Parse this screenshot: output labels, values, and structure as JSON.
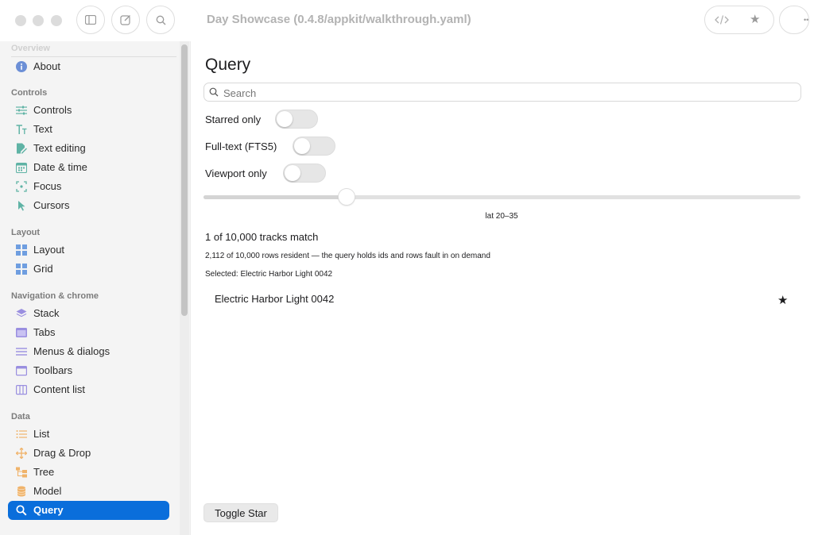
{
  "window": {
    "title": "Day Showcase (0.4.8/appkit/walkthrough.yaml)"
  },
  "toolbar": {
    "sidebar_toggle_icon": "sidebar-icon",
    "compose_icon": "compose-icon",
    "search_icon": "search-icon",
    "code_icon": "code-icon",
    "star_icon": "star-icon",
    "more_icon": "ellipsis-icon"
  },
  "sidebar": {
    "top_faded_section": "Overview",
    "sections": [
      {
        "title": "",
        "items": [
          {
            "label": "About",
            "icon": "info-icon",
            "color": "#6c8fd6"
          }
        ]
      },
      {
        "title": "Controls",
        "items": [
          {
            "label": "Controls",
            "icon": "sliders-icon",
            "color": "#5fb3a5"
          },
          {
            "label": "Text",
            "icon": "text-size-icon",
            "color": "#5fb3a5"
          },
          {
            "label": "Text editing",
            "icon": "edit-doc-icon",
            "color": "#5fb3a5"
          },
          {
            "label": "Date & time",
            "icon": "calendar-icon",
            "color": "#5fb3a5"
          },
          {
            "label": "Focus",
            "icon": "focus-icon",
            "color": "#5fb3a5"
          },
          {
            "label": "Cursors",
            "icon": "cursor-icon",
            "color": "#5fb3a5"
          }
        ]
      },
      {
        "title": "Layout",
        "items": [
          {
            "label": "Layout",
            "icon": "grid-icon",
            "color": "#6f9ee0"
          },
          {
            "label": "Grid",
            "icon": "grid-icon",
            "color": "#6f9ee0"
          }
        ]
      },
      {
        "title": "Navigation & chrome",
        "items": [
          {
            "label": "Stack",
            "icon": "stack-icon",
            "color": "#9a8fe0"
          },
          {
            "label": "Tabs",
            "icon": "tabs-icon",
            "color": "#9a8fe0"
          },
          {
            "label": "Menus & dialogs",
            "icon": "menu-icon",
            "color": "#9a8fe0"
          },
          {
            "label": "Toolbars",
            "icon": "window-icon",
            "color": "#9a8fe0"
          },
          {
            "label": "Content list",
            "icon": "columns-icon",
            "color": "#9a8fe0"
          }
        ]
      },
      {
        "title": "Data",
        "items": [
          {
            "label": "List",
            "icon": "list-icon",
            "color": "#f0b36a"
          },
          {
            "label": "Drag & Drop",
            "icon": "move-icon",
            "color": "#f0b36a"
          },
          {
            "label": "Tree",
            "icon": "tree-icon",
            "color": "#f0b36a"
          },
          {
            "label": "Model",
            "icon": "database-icon",
            "color": "#f0b36a"
          },
          {
            "label": "Query",
            "icon": "magnifier-icon",
            "color": "#ffffff",
            "selected": true
          }
        ]
      }
    ]
  },
  "main": {
    "title": "Query",
    "search_placeholder": "Search",
    "search_value": "",
    "toggles": [
      {
        "label": "Starred only",
        "on": false
      },
      {
        "label": "Full-text (FTS5)",
        "on": false
      },
      {
        "label": "Viewport only",
        "on": false
      }
    ],
    "slider": {
      "fraction": 0.24,
      "label": "lat 20–35"
    },
    "match_text": "1 of 10,000 tracks match",
    "resident_text": "2,112 of 10,000 rows resident — the query holds ids and rows fault in on demand",
    "selected_text": "Selected: Electric Harbor Light 0042",
    "results": [
      {
        "name": "Electric Harbor Light 0042",
        "starred": true
      }
    ],
    "toggle_star_button": "Toggle Star"
  }
}
